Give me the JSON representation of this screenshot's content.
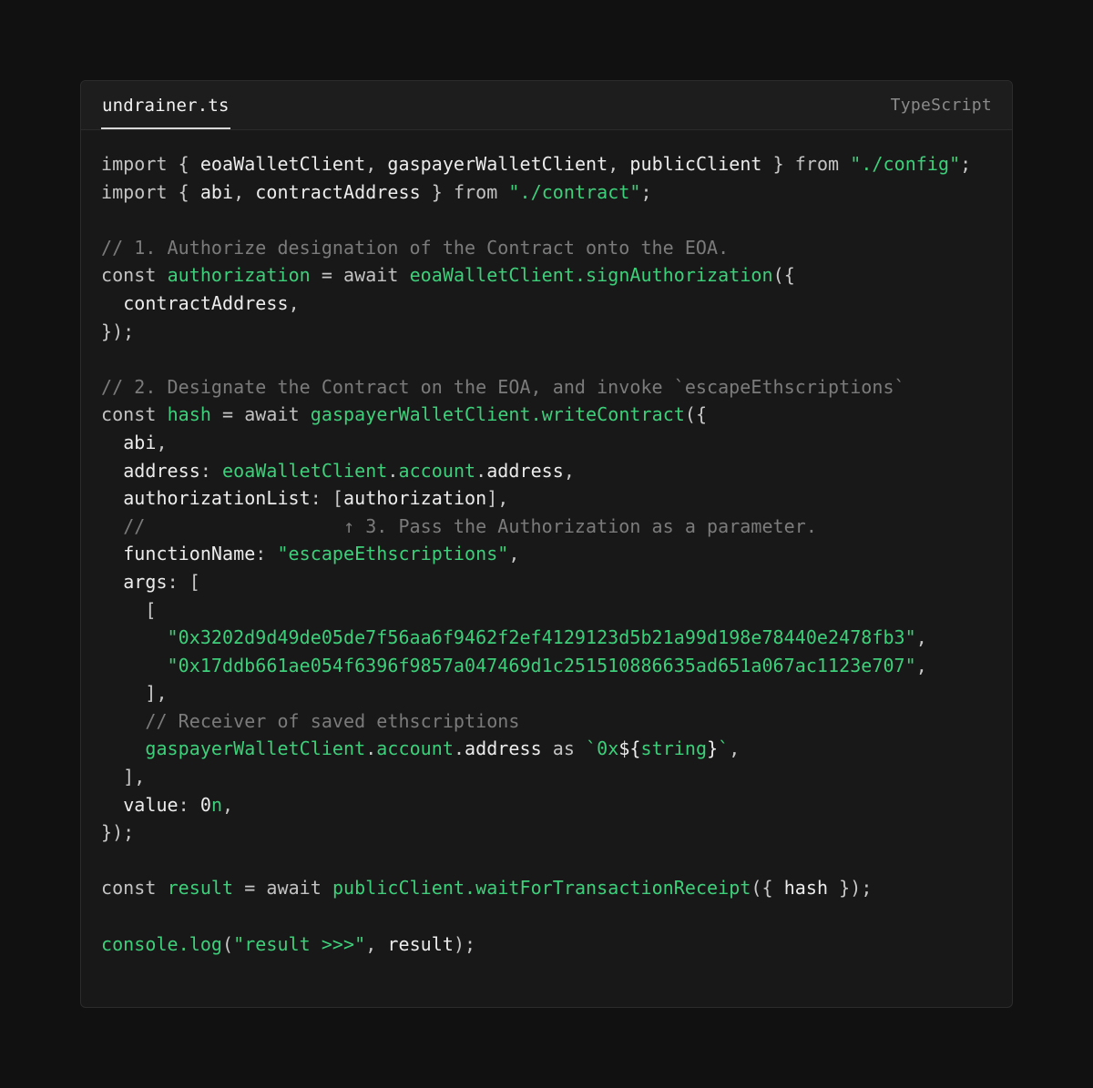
{
  "editor": {
    "filename": "undrainer.ts",
    "language": "TypeScript",
    "colors": {
      "background": "#111111",
      "panel": "#181818",
      "accent_green": "#3ecf7a",
      "comment_gray": "#7b7b7b",
      "text": "#ececec"
    }
  },
  "code_lines": [
    [
      [
        "kw",
        "import"
      ],
      [
        "pu",
        " { "
      ],
      [
        "pl",
        "eoaWalletClient"
      ],
      [
        "pu",
        ", "
      ],
      [
        "pl",
        "gaspayerWalletClient"
      ],
      [
        "pu",
        ", "
      ],
      [
        "pl",
        "publicClient"
      ],
      [
        "pu",
        " } "
      ],
      [
        "kw",
        "from"
      ],
      [
        "pu",
        " "
      ],
      [
        "str",
        "\"./config\""
      ],
      [
        "pu",
        ";"
      ]
    ],
    [
      [
        "kw",
        "import"
      ],
      [
        "pu",
        " { "
      ],
      [
        "pl",
        "abi"
      ],
      [
        "pu",
        ", "
      ],
      [
        "pl",
        "contractAddress"
      ],
      [
        "pu",
        " } "
      ],
      [
        "kw",
        "from"
      ],
      [
        "pu",
        " "
      ],
      [
        "str",
        "\"./contract\""
      ],
      [
        "pu",
        ";"
      ]
    ],
    [],
    [
      [
        "cm",
        "// 1. Authorize designation of the Contract onto the EOA."
      ]
    ],
    [
      [
        "kw",
        "const"
      ],
      [
        "pu",
        " "
      ],
      [
        "fn",
        "authorization"
      ],
      [
        "pu",
        " = "
      ],
      [
        "kw",
        "await"
      ],
      [
        "pu",
        " "
      ],
      [
        "fn",
        "eoaWalletClient.signAuthorization"
      ],
      [
        "pu",
        "({"
      ]
    ],
    [
      [
        "pu",
        "  "
      ],
      [
        "pl",
        "contractAddress"
      ],
      [
        "pu",
        ","
      ]
    ],
    [
      [
        "pu",
        "});"
      ]
    ],
    [],
    [
      [
        "cm",
        "// 2. Designate the Contract on the EOA, and invoke `escapeEthscriptions`"
      ]
    ],
    [
      [
        "kw",
        "const"
      ],
      [
        "pu",
        " "
      ],
      [
        "fn",
        "hash"
      ],
      [
        "pu",
        " = "
      ],
      [
        "kw",
        "await"
      ],
      [
        "pu",
        " "
      ],
      [
        "fn",
        "gaspayerWalletClient.writeContract"
      ],
      [
        "pu",
        "({"
      ]
    ],
    [
      [
        "pu",
        "  "
      ],
      [
        "pl",
        "abi"
      ],
      [
        "pu",
        ","
      ]
    ],
    [
      [
        "pu",
        "  "
      ],
      [
        "pl",
        "address"
      ],
      [
        "pu",
        ": "
      ],
      [
        "fn",
        "eoaWalletClient"
      ],
      [
        "pu",
        "."
      ],
      [
        "fn",
        "account"
      ],
      [
        "pu",
        "."
      ],
      [
        "pl",
        "address"
      ],
      [
        "pu",
        ","
      ]
    ],
    [
      [
        "pu",
        "  "
      ],
      [
        "pl",
        "authorizationList"
      ],
      [
        "pu",
        ": ["
      ],
      [
        "pl",
        "authorization"
      ],
      [
        "pu",
        "],"
      ]
    ],
    [
      [
        "pu",
        "  "
      ],
      [
        "cm",
        "//                  ↑ 3. Pass the Authorization as a parameter."
      ]
    ],
    [
      [
        "pu",
        "  "
      ],
      [
        "pl",
        "functionName"
      ],
      [
        "pu",
        ": "
      ],
      [
        "str",
        "\"escapeEthscriptions\""
      ],
      [
        "pu",
        ","
      ]
    ],
    [
      [
        "pu",
        "  "
      ],
      [
        "pl",
        "args"
      ],
      [
        "pu",
        ": ["
      ]
    ],
    [
      [
        "pu",
        "    ["
      ]
    ],
    [
      [
        "pu",
        "      "
      ],
      [
        "str",
        "\"0x3202d9d49de05de7f56aa6f9462f2ef4129123d5b21a99d198e78440e2478fb3\""
      ],
      [
        "pu",
        ","
      ]
    ],
    [
      [
        "pu",
        "      "
      ],
      [
        "str",
        "\"0x17ddb661ae054f6396f9857a047469d1c251510886635ad651a067ac1123e707\""
      ],
      [
        "pu",
        ","
      ]
    ],
    [
      [
        "pu",
        "    ],"
      ]
    ],
    [
      [
        "pu",
        "    "
      ],
      [
        "cm",
        "// Receiver of saved ethscriptions"
      ]
    ],
    [
      [
        "pu",
        "    "
      ],
      [
        "fn",
        "gaspayerWalletClient"
      ],
      [
        "pu",
        "."
      ],
      [
        "fn",
        "account"
      ],
      [
        "pu",
        "."
      ],
      [
        "pl",
        "address"
      ],
      [
        "pu",
        " "
      ],
      [
        "kw",
        "as"
      ],
      [
        "pu",
        " "
      ],
      [
        "str",
        "`0x"
      ],
      [
        "pl",
        "${"
      ],
      [
        "str",
        "string"
      ],
      [
        "pl",
        "}"
      ],
      [
        "str",
        "`"
      ],
      [
        "pu",
        ","
      ]
    ],
    [
      [
        "pu",
        "  ],"
      ]
    ],
    [
      [
        "pu",
        "  "
      ],
      [
        "pl",
        "value"
      ],
      [
        "pu",
        ": "
      ],
      [
        "pl",
        "0"
      ],
      [
        "str",
        "n"
      ],
      [
        "pu",
        ","
      ]
    ],
    [
      [
        "pu",
        "});"
      ]
    ],
    [],
    [
      [
        "kw",
        "const"
      ],
      [
        "pu",
        " "
      ],
      [
        "fn",
        "result"
      ],
      [
        "pu",
        " = "
      ],
      [
        "kw",
        "await"
      ],
      [
        "pu",
        " "
      ],
      [
        "fn",
        "publicClient.waitForTransactionReceipt"
      ],
      [
        "pu",
        "({ "
      ],
      [
        "pl",
        "hash"
      ],
      [
        "pu",
        " });"
      ]
    ],
    [],
    [
      [
        "fn",
        "console.log"
      ],
      [
        "pu",
        "("
      ],
      [
        "str",
        "\"result >>>\""
      ],
      [
        "pu",
        ", "
      ],
      [
        "pl",
        "result"
      ],
      [
        "pu",
        ");"
      ]
    ]
  ]
}
